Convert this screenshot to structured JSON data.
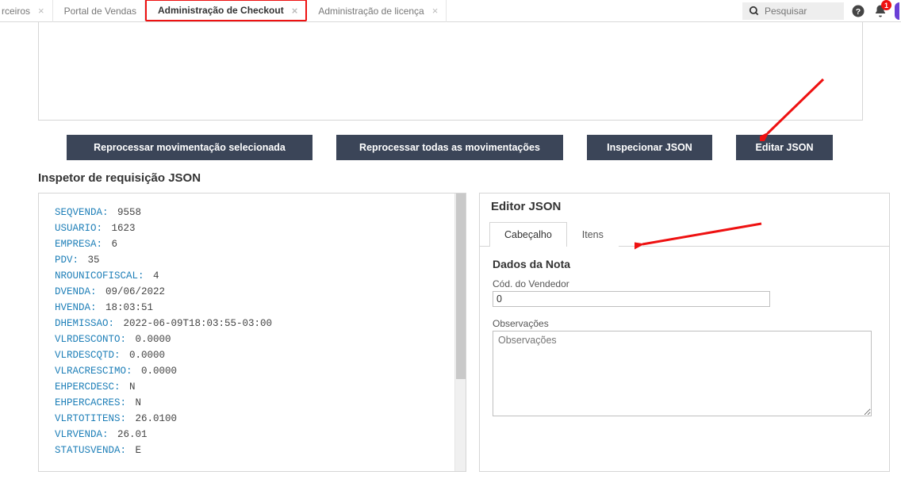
{
  "tabs": {
    "items": [
      {
        "label": "rceiros",
        "closable": true
      },
      {
        "label": "Portal de Vendas",
        "closable": false
      },
      {
        "label": "Administração de Checkout",
        "closable": true,
        "active": true
      },
      {
        "label": "Administração de licença",
        "closable": true
      }
    ]
  },
  "search": {
    "placeholder": "Pesquisar"
  },
  "notifications": {
    "count": "1"
  },
  "buttons": {
    "reprocess_selected": "Reprocessar movimentação selecionada",
    "reprocess_all": "Reprocessar todas as movimentações",
    "inspect_json": "Inspecionar JSON",
    "edit_json": "Editar JSON"
  },
  "inspector": {
    "title": "Inspetor de requisição JSON",
    "lines": [
      {
        "key": "SEQVENDA",
        "val": "9558"
      },
      {
        "key": "USUARIO",
        "val": "1623"
      },
      {
        "key": "EMPRESA",
        "val": "6"
      },
      {
        "key": "PDV",
        "val": "35"
      },
      {
        "key": "NROUNICOFISCAL",
        "val": "4"
      },
      {
        "key": "DVENDA",
        "val": "09/06/2022"
      },
      {
        "key": "HVENDA",
        "val": "18:03:51"
      },
      {
        "key": "DHEMISSAO",
        "val": "2022-06-09T18:03:55-03:00"
      },
      {
        "key": "VLRDESCONTO",
        "val": "0.0000"
      },
      {
        "key": "VLRDESCQTD",
        "val": "0.0000"
      },
      {
        "key": "VLRACRESCIMO",
        "val": "0.0000"
      },
      {
        "key": "EHPERCDESC",
        "val": "N"
      },
      {
        "key": "EHPERCACRES",
        "val": "N"
      },
      {
        "key": "VLRTOTITENS",
        "val": "26.0100"
      },
      {
        "key": "VLRVENDA",
        "val": "26.01"
      },
      {
        "key": "STATUSVENDA",
        "val": "E"
      }
    ]
  },
  "editor": {
    "title": "Editor JSON",
    "tabs": {
      "header": "Cabeçalho",
      "items": "Itens"
    },
    "section_title": "Dados da Nota",
    "field_vendor_label": "Cód. do Vendedor",
    "field_vendor_value": "0",
    "obs_label": "Observações",
    "obs_placeholder": "Observações"
  }
}
